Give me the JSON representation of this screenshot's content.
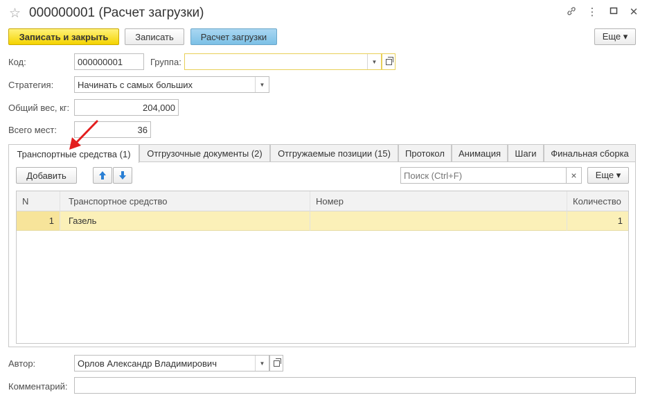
{
  "window": {
    "title": "000000001 (Расчет загрузки)",
    "star_glyph": "☆",
    "link_glyph": "🔗",
    "more_glyph": "⋮",
    "max_glyph": "☐",
    "close_glyph": "✕"
  },
  "toolbar": {
    "save_close_label": "Записать и закрыть",
    "save_label": "Записать",
    "calc_label": "Расчет загрузки",
    "more_label": "Еще ▾"
  },
  "form": {
    "code_label": "Код:",
    "code_value": "000000001",
    "group_label": "Группа:",
    "group_value": "",
    "strategy_label": "Стратегия:",
    "strategy_value": "Начинать с самых больших",
    "weight_label": "Общий вес, кг:",
    "weight_value": "204,000",
    "places_label": "Всего мест:",
    "places_value": "36",
    "author_label": "Автор:",
    "author_value": "Орлов Александр Владимирович",
    "comment_label": "Комментарий:",
    "comment_value": ""
  },
  "tabs": [
    {
      "label": "Транспортные средства (1)",
      "active": true
    },
    {
      "label": "Отгрузочные документы (2)",
      "active": false
    },
    {
      "label": "Отгружаемые позиции (15)",
      "active": false
    },
    {
      "label": "Протокол",
      "active": false
    },
    {
      "label": "Анимация",
      "active": false
    },
    {
      "label": "Шаги",
      "active": false
    },
    {
      "label": "Финальная сборка",
      "active": false
    }
  ],
  "table_toolbar": {
    "add_label": "Добавить",
    "search_placeholder": "Поиск (Ctrl+F)",
    "clear_glyph": "×",
    "more_label": "Еще ▾"
  },
  "table": {
    "columns": [
      "N",
      "Транспортное средство",
      "Номер",
      "Количество"
    ],
    "rows": [
      {
        "n": "1",
        "vehicle": "Газель",
        "number": "",
        "qty": "1"
      }
    ]
  },
  "colors": {
    "primary_button": "#f4d300",
    "calc_button": "#7cc0e6",
    "selected_row": "#fbf0b8",
    "annotation_arrow": "#e31e1e"
  }
}
